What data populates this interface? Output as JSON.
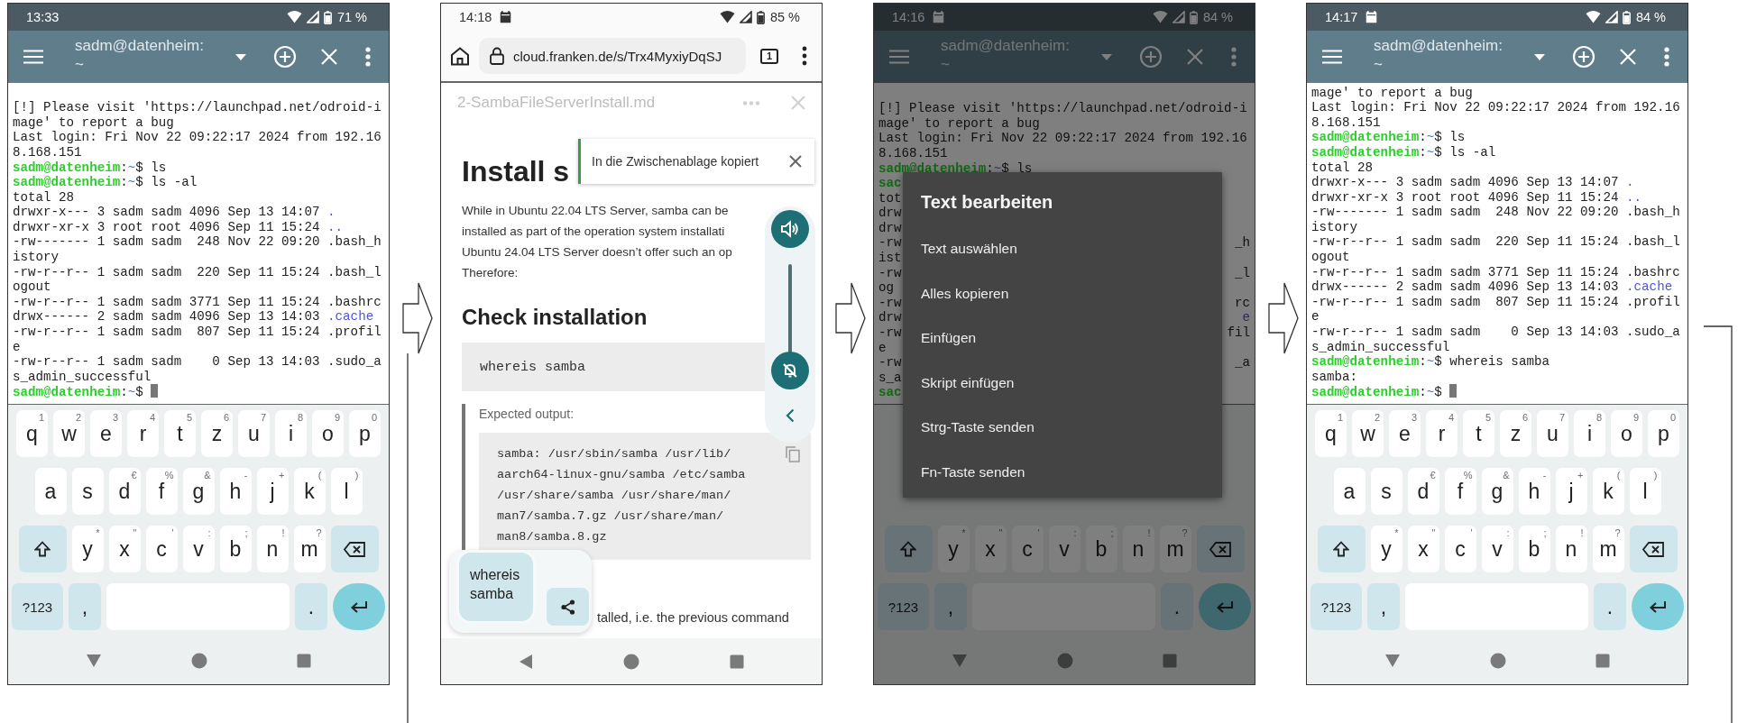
{
  "screens": [
    {
      "kind": "terminal",
      "status": {
        "time": "13:33",
        "notification": false,
        "battery": "71 %"
      },
      "toolbar": {
        "title": "sadm@datenheim: ~"
      },
      "terminal": {
        "lines": [
          {
            "segments": [
              {
                "text": "[!] Please visit 'https://launchpad.net/odroid-i"
              }
            ]
          },
          {
            "segments": [
              {
                "text": "mage' to report a bug"
              }
            ]
          },
          {
            "segments": [
              {
                "text": "Last login: Fri Nov 22 09:22:17 2024 from 192.16"
              }
            ]
          },
          {
            "segments": [
              {
                "text": "8.168.151"
              }
            ]
          },
          {
            "segments": [
              {
                "kind": "user",
                "text": "sadm@datenheim"
              },
              {
                "text": ":"
              },
              {
                "kind": "path",
                "text": "~"
              },
              {
                "text": "$ ls"
              }
            ]
          },
          {
            "segments": [
              {
                "kind": "user",
                "text": "sadm@datenheim"
              },
              {
                "text": ":"
              },
              {
                "kind": "path",
                "text": "~"
              },
              {
                "text": "$ ls -al"
              }
            ]
          },
          {
            "segments": [
              {
                "text": "total 28"
              }
            ]
          },
          {
            "segments": [
              {
                "text": "drwxr-x--- 3 sadm sadm 4096 Sep 13 14:07 "
              },
              {
                "kind": "dir",
                "text": "."
              }
            ]
          },
          {
            "segments": [
              {
                "text": "drwxr-xr-x 3 root root 4096 Sep 11 15:24 "
              },
              {
                "kind": "dir",
                "text": ".."
              }
            ]
          },
          {
            "segments": [
              {
                "text": "-rw------- 1 sadm sadm  248 Nov 22 09:20 .bash_h"
              }
            ]
          },
          {
            "segments": [
              {
                "text": "istory"
              }
            ]
          },
          {
            "segments": [
              {
                "text": "-rw-r--r-- 1 sadm sadm  220 Sep 11 15:24 .bash_l"
              }
            ]
          },
          {
            "segments": [
              {
                "text": "ogout"
              }
            ]
          },
          {
            "segments": [
              {
                "text": "-rw-r--r-- 1 sadm sadm 3771 Sep 11 15:24 .bashrc"
              }
            ]
          },
          {
            "segments": [
              {
                "text": "drwx------ 2 sadm sadm 4096 Sep 13 14:03 "
              },
              {
                "kind": "dir",
                "text": ".cache"
              }
            ]
          },
          {
            "segments": [
              {
                "text": "-rw-r--r-- 1 sadm sadm  807 Sep 11 15:24 .profil"
              }
            ]
          },
          {
            "segments": [
              {
                "text": "e"
              }
            ]
          },
          {
            "segments": [
              {
                "text": "-rw-r--r-- 1 sadm sadm    0 Sep 13 14:03 .sudo_a"
              }
            ]
          },
          {
            "segments": [
              {
                "text": "s_admin_successful"
              }
            ]
          },
          {
            "segments": [
              {
                "kind": "user",
                "text": "sadm@datenheim"
              },
              {
                "text": ":"
              },
              {
                "kind": "path",
                "text": "~"
              },
              {
                "text": "$ "
              },
              {
                "kind": "cursor"
              }
            ]
          }
        ]
      },
      "keyboard": {
        "rows": [
          {
            "keys": [
              {
                "kind": "letter",
                "label": "q",
                "hint": "1"
              },
              {
                "kind": "letter",
                "label": "w",
                "hint": "2"
              },
              {
                "kind": "letter",
                "label": "e",
                "hint": "3"
              },
              {
                "kind": "letter",
                "label": "r",
                "hint": "4"
              },
              {
                "kind": "letter",
                "label": "t",
                "hint": "5"
              },
              {
                "kind": "letter",
                "label": "z",
                "hint": "6"
              },
              {
                "kind": "letter",
                "label": "u",
                "hint": "7"
              },
              {
                "kind": "letter",
                "label": "i",
                "hint": "8"
              },
              {
                "kind": "letter",
                "label": "o",
                "hint": "9"
              },
              {
                "kind": "letter",
                "label": "p",
                "hint": "0"
              }
            ]
          },
          {
            "keys": [
              {
                "kind": "letter",
                "label": "a"
              },
              {
                "kind": "letter",
                "label": "s"
              },
              {
                "kind": "letter",
                "label": "d",
                "hint": "€"
              },
              {
                "kind": "letter",
                "label": "f",
                "hint": "%"
              },
              {
                "kind": "letter",
                "label": "g",
                "hint": "&"
              },
              {
                "kind": "letter",
                "label": "h",
                "hint": "-"
              },
              {
                "kind": "letter",
                "label": "j",
                "hint": "+"
              },
              {
                "kind": "letter",
                "label": "k",
                "hint": "("
              },
              {
                "kind": "letter",
                "label": "l",
                "hint": ")"
              }
            ]
          },
          {
            "keys": [
              {
                "kind": "shift"
              },
              {
                "kind": "letter",
                "label": "y",
                "hint": "*"
              },
              {
                "kind": "letter",
                "label": "x",
                "hint": "\""
              },
              {
                "kind": "letter",
                "label": "c",
                "hint": "'"
              },
              {
                "kind": "letter",
                "label": "v",
                "hint": ":"
              },
              {
                "kind": "letter",
                "label": "b",
                "hint": ";"
              },
              {
                "kind": "letter",
                "label": "n",
                "hint": "!"
              },
              {
                "kind": "letter",
                "label": "m",
                "hint": "?"
              },
              {
                "kind": "backspace"
              }
            ]
          },
          {
            "keys": [
              {
                "kind": "mode",
                "label": "?123"
              },
              {
                "kind": "punct",
                "label": ","
              },
              {
                "kind": "space"
              },
              {
                "kind": "punct",
                "label": "."
              },
              {
                "kind": "enter"
              }
            ]
          }
        ]
      }
    },
    {
      "kind": "browser",
      "status": {
        "time": "14:18",
        "notification": true,
        "battery": "85 %"
      },
      "address_bar": {
        "url": "cloud.franken.de/s/Trx4MyxiyDqSJ",
        "tab_count": "1"
      },
      "document": {
        "title": "2-SambaFileServerInstall.md",
        "heading": "Install s",
        "paragraph": [
          "While in Ubuntu 22.04 LTS Server, samba can be",
          "installed as part of the operation system installati",
          "Ubuntu 24.04 LTS Server doesn’t offer such an op",
          "Therefore:"
        ],
        "section_heading": "Check installation",
        "command": "whereis samba",
        "quote_label": "Expected output:",
        "output": [
          "samba: /usr/sbin/samba /usr/lib/",
          "aarch64-linux-gnu/samba /etc/samba",
          "/usr/share/samba /usr/share/man/",
          "man7/samba.7.gz /usr/share/man/",
          "man8/samba.8.gz"
        ],
        "trailing_text": "talled, i.e. the previous command"
      },
      "toast": {
        "text": "In die Zwischenablage kopiert"
      },
      "volume_panel": {
        "level": 0
      },
      "clipboard_chip": {
        "text": "whereis samba"
      }
    },
    {
      "kind": "terminal",
      "status": {
        "time": "14:16",
        "notification": true,
        "battery": "84 %"
      },
      "toolbar": {
        "title": "sadm@datenheim: ~"
      },
      "terminal": {
        "lines": [
          {
            "segments": [
              {
                "text": "[!] Please visit 'https://launchpad.net/odroid-i"
              }
            ]
          },
          {
            "segments": [
              {
                "text": "mage' to report a bug"
              }
            ]
          },
          {
            "segments": [
              {
                "text": "Last login: Fri Nov 22 09:22:17 2024 from 192.16"
              }
            ]
          },
          {
            "segments": [
              {
                "text": "8.168.151"
              }
            ]
          },
          {
            "segments": [
              {
                "kind": "user",
                "text": "sadm@datenheim"
              },
              {
                "text": ":"
              },
              {
                "kind": "path",
                "text": "~"
              },
              {
                "text": "$ ls"
              }
            ]
          },
          {
            "kind": "covered",
            "left": [
              {
                "kind": "user",
                "text": "sac"
              }
            ]
          },
          {
            "kind": "covered",
            "left": [
              {
                "text": "tot"
              }
            ]
          },
          {
            "kind": "covered",
            "left": [
              {
                "text": "drw"
              }
            ]
          },
          {
            "kind": "covered",
            "left": [
              {
                "text": "drw"
              }
            ]
          },
          {
            "kind": "covered",
            "left": [
              {
                "text": "-rw"
              }
            ],
            "right": [
              {
                "text": "_h"
              }
            ]
          },
          {
            "kind": "covered",
            "left": [
              {
                "text": "ist"
              }
            ]
          },
          {
            "kind": "covered",
            "left": [
              {
                "text": "-rw"
              }
            ],
            "right": [
              {
                "text": "_l"
              }
            ]
          },
          {
            "kind": "covered",
            "left": [
              {
                "text": "og"
              }
            ]
          },
          {
            "kind": "covered",
            "left": [
              {
                "text": "-rw"
              }
            ],
            "right": [
              {
                "text": "rc"
              }
            ]
          },
          {
            "kind": "covered",
            "left": [
              {
                "text": "drw"
              }
            ],
            "right": [
              {
                "kind": "dir",
                "text": "e"
              }
            ]
          },
          {
            "kind": "covered",
            "left": [
              {
                "text": "-rw"
              }
            ],
            "right": [
              {
                "text": "fil"
              }
            ]
          },
          {
            "kind": "covered",
            "left": [
              {
                "text": "e"
              }
            ]
          },
          {
            "kind": "covered",
            "left": [
              {
                "text": "-rw"
              }
            ],
            "right": [
              {
                "text": "_a"
              }
            ]
          },
          {
            "kind": "covered",
            "left": [
              {
                "text": "s_a"
              }
            ]
          },
          {
            "kind": "covered",
            "left": [
              {
                "kind": "user",
                "text": "sac"
              }
            ]
          }
        ]
      },
      "keyboard": {
        "rows": [
          {
            "keys": [
              {
                "kind": "shift"
              },
              {
                "kind": "letter",
                "label": "y",
                "hint": "*"
              },
              {
                "kind": "letter",
                "label": "x",
                "hint": "\""
              },
              {
                "kind": "letter",
                "label": "c",
                "hint": "'"
              },
              {
                "kind": "letter",
                "label": "v",
                "hint": ":"
              },
              {
                "kind": "letter",
                "label": "b",
                "hint": ";"
              },
              {
                "kind": "letter",
                "label": "n",
                "hint": "!"
              },
              {
                "kind": "letter",
                "label": "m",
                "hint": "?"
              },
              {
                "kind": "backspace"
              }
            ]
          },
          {
            "keys": [
              {
                "kind": "mode",
                "label": "?123"
              },
              {
                "kind": "punct",
                "label": ","
              },
              {
                "kind": "space"
              },
              {
                "kind": "punct",
                "label": "."
              },
              {
                "kind": "enter"
              }
            ]
          }
        ]
      },
      "dialog": {
        "title": "Text bearbeiten",
        "items": [
          "Text auswählen",
          "Alles kopieren",
          "Einfügen",
          "Skript einfügen",
          "Strg-Taste senden",
          "Fn-Taste senden"
        ]
      }
    },
    {
      "kind": "terminal",
      "status": {
        "time": "14:17",
        "notification": true,
        "battery": "84 %"
      },
      "toolbar": {
        "title": "sadm@datenheim: ~"
      },
      "terminal": {
        "lines": [
          {
            "segments": [
              {
                "text": "mage' to report a bug"
              }
            ]
          },
          {
            "segments": [
              {
                "text": "Last login: Fri Nov 22 09:22:17 2024 from 192.16"
              }
            ]
          },
          {
            "segments": [
              {
                "text": "8.168.151"
              }
            ]
          },
          {
            "segments": [
              {
                "kind": "user",
                "text": "sadm@datenheim"
              },
              {
                "text": ":"
              },
              {
                "kind": "path",
                "text": "~"
              },
              {
                "text": "$ ls"
              }
            ]
          },
          {
            "segments": [
              {
                "kind": "user",
                "text": "sadm@datenheim"
              },
              {
                "text": ":"
              },
              {
                "kind": "path",
                "text": "~"
              },
              {
                "text": "$ ls -al"
              }
            ]
          },
          {
            "segments": [
              {
                "text": "total 28"
              }
            ]
          },
          {
            "segments": [
              {
                "text": "drwxr-x--- 3 sadm sadm 4096 Sep 13 14:07 "
              },
              {
                "kind": "dir",
                "text": "."
              }
            ]
          },
          {
            "segments": [
              {
                "text": "drwxr-xr-x 3 root root 4096 Sep 11 15:24 "
              },
              {
                "kind": "dir",
                "text": ".."
              }
            ]
          },
          {
            "segments": [
              {
                "text": "-rw------- 1 sadm sadm  248 Nov 22 09:20 .bash_h"
              }
            ]
          },
          {
            "segments": [
              {
                "text": "istory"
              }
            ]
          },
          {
            "segments": [
              {
                "text": "-rw-r--r-- 1 sadm sadm  220 Sep 11 15:24 .bash_l"
              }
            ]
          },
          {
            "segments": [
              {
                "text": "ogout"
              }
            ]
          },
          {
            "segments": [
              {
                "text": "-rw-r--r-- 1 sadm sadm 3771 Sep 11 15:24 .bashrc"
              }
            ]
          },
          {
            "segments": [
              {
                "text": "drwx------ 2 sadm sadm 4096 Sep 13 14:03 "
              },
              {
                "kind": "dir",
                "text": ".cache"
              }
            ]
          },
          {
            "segments": [
              {
                "text": "-rw-r--r-- 1 sadm sadm  807 Sep 11 15:24 .profil"
              }
            ]
          },
          {
            "segments": [
              {
                "text": "e"
              }
            ]
          },
          {
            "segments": [
              {
                "text": "-rw-r--r-- 1 sadm sadm    0 Sep 13 14:03 .sudo_a"
              }
            ]
          },
          {
            "segments": [
              {
                "text": "s_admin_successful"
              }
            ]
          },
          {
            "segments": [
              {
                "kind": "user",
                "text": "sadm@datenheim"
              },
              {
                "text": ":"
              },
              {
                "kind": "path",
                "text": "~"
              },
              {
                "text": "$ whereis samba"
              }
            ]
          },
          {
            "segments": [
              {
                "text": "samba:"
              }
            ]
          },
          {
            "segments": [
              {
                "kind": "user",
                "text": "sadm@datenheim"
              },
              {
                "text": ":"
              },
              {
                "kind": "path",
                "text": "~"
              },
              {
                "text": "$ "
              },
              {
                "kind": "cursor"
              }
            ]
          }
        ]
      },
      "keyboard": {
        "rows": [
          {
            "keys": [
              {
                "kind": "letter",
                "label": "q",
                "hint": "1"
              },
              {
                "kind": "letter",
                "label": "w",
                "hint": "2"
              },
              {
                "kind": "letter",
                "label": "e",
                "hint": "3"
              },
              {
                "kind": "letter",
                "label": "r",
                "hint": "4"
              },
              {
                "kind": "letter",
                "label": "t",
                "hint": "5"
              },
              {
                "kind": "letter",
                "label": "z",
                "hint": "6"
              },
              {
                "kind": "letter",
                "label": "u",
                "hint": "7"
              },
              {
                "kind": "letter",
                "label": "i",
                "hint": "8"
              },
              {
                "kind": "letter",
                "label": "o",
                "hint": "9"
              },
              {
                "kind": "letter",
                "label": "p",
                "hint": "0"
              }
            ]
          },
          {
            "keys": [
              {
                "kind": "letter",
                "label": "a"
              },
              {
                "kind": "letter",
                "label": "s"
              },
              {
                "kind": "letter",
                "label": "d",
                "hint": "€"
              },
              {
                "kind": "letter",
                "label": "f",
                "hint": "%"
              },
              {
                "kind": "letter",
                "label": "g",
                "hint": "&"
              },
              {
                "kind": "letter",
                "label": "h",
                "hint": "-"
              },
              {
                "kind": "letter",
                "label": "j",
                "hint": "+"
              },
              {
                "kind": "letter",
                "label": "k",
                "hint": "("
              },
              {
                "kind": "letter",
                "label": "l",
                "hint": ")"
              }
            ]
          },
          {
            "keys": [
              {
                "kind": "shift"
              },
              {
                "kind": "letter",
                "label": "y",
                "hint": "*"
              },
              {
                "kind": "letter",
                "label": "x",
                "hint": "\""
              },
              {
                "kind": "letter",
                "label": "c",
                "hint": "'"
              },
              {
                "kind": "letter",
                "label": "v",
                "hint": ":"
              },
              {
                "kind": "letter",
                "label": "b",
                "hint": ";"
              },
              {
                "kind": "letter",
                "label": "n",
                "hint": "!"
              },
              {
                "kind": "letter",
                "label": "m",
                "hint": "?"
              },
              {
                "kind": "backspace"
              }
            ]
          },
          {
            "keys": [
              {
                "kind": "mode",
                "label": "?123"
              },
              {
                "kind": "punct",
                "label": ","
              },
              {
                "kind": "space"
              },
              {
                "kind": "punct",
                "label": "."
              },
              {
                "kind": "enter"
              }
            ]
          }
        ]
      }
    }
  ]
}
